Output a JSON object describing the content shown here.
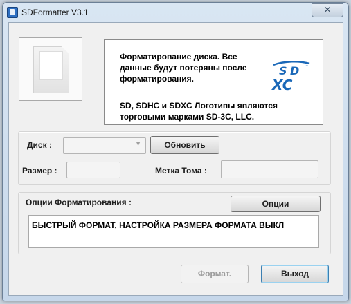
{
  "window": {
    "title": "SDFormatter V3.1",
    "close_label": "✕"
  },
  "info": {
    "line1": "Форматирование диска. Все данные будут потеряны после форматирования.",
    "line2": "SD, SDHC и SDXC Логотипы являются торговыми марками SD-3C, LLC.",
    "logo": "sdxc-logo"
  },
  "drive": {
    "disk_label": "Диск :",
    "disk_value": "",
    "refresh_label": "Обновить",
    "size_label": "Размер :",
    "size_value": "",
    "volume_label": "Метка Тома :",
    "volume_value": ""
  },
  "options": {
    "label": "Опции Форматирования :",
    "button_label": "Опции",
    "summary": "БЫСТРЫЙ ФОРМАТ, НАСТРОЙКА РАЗМЕРА ФОРМАТА ВЫКЛ"
  },
  "actions": {
    "format_label": "Формат.",
    "exit_label": "Выход"
  },
  "colors": {
    "logo_blue": "#1a68b8"
  }
}
